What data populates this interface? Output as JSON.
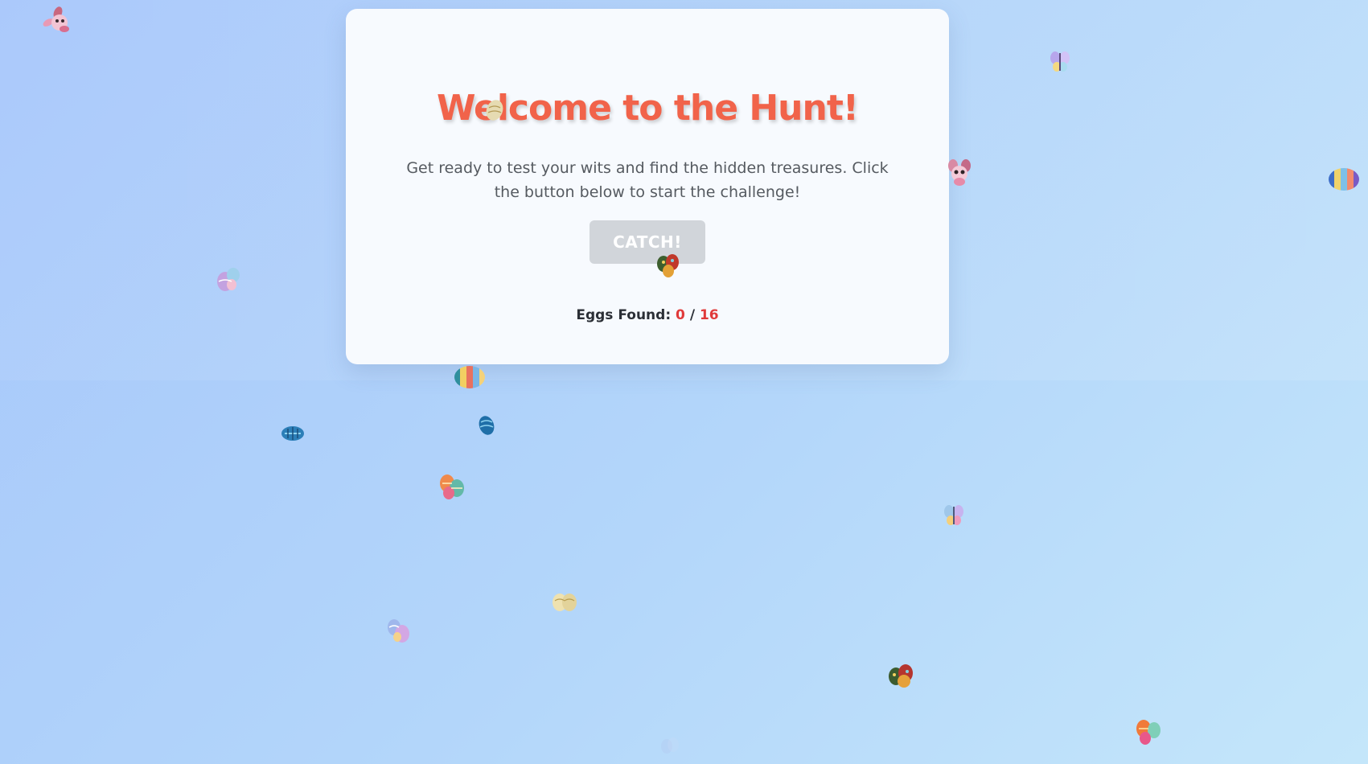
{
  "card": {
    "title": "Welcome to the Hunt!",
    "description": "Get ready to test your wits and find the hidden treasures. Click the button below to start the challenge!",
    "button_label": "CATCH!",
    "counter_label": "Eggs Found:",
    "found": "0",
    "separator": "/",
    "total": "16"
  },
  "colors": {
    "title": "#f1634a",
    "counter_value": "#e03a3a",
    "button_disabled": "#d1d5da",
    "card_background": "#f7fafe",
    "page_background": "#b3d6fa"
  },
  "eggs": [
    {
      "icon": "bunny-icon"
    },
    {
      "icon": "butterfly-icon"
    },
    {
      "icon": "bunny-icon"
    },
    {
      "icon": "striped-egg-icon"
    },
    {
      "icon": "pastel-eggs-icon"
    },
    {
      "icon": "striped-egg-icon"
    },
    {
      "icon": "blue-egg-icon"
    },
    {
      "icon": "blue-egg-icon"
    },
    {
      "icon": "egg-cluster-icon"
    },
    {
      "icon": "butterfly-icon"
    },
    {
      "icon": "golden-eggs-icon"
    },
    {
      "icon": "pastel-eggs-icon"
    },
    {
      "icon": "egg-cluster-icon"
    },
    {
      "icon": "egg-cluster-icon"
    },
    {
      "icon": "golden-eggs-icon"
    },
    {
      "icon": "egg-cluster-icon"
    }
  ]
}
